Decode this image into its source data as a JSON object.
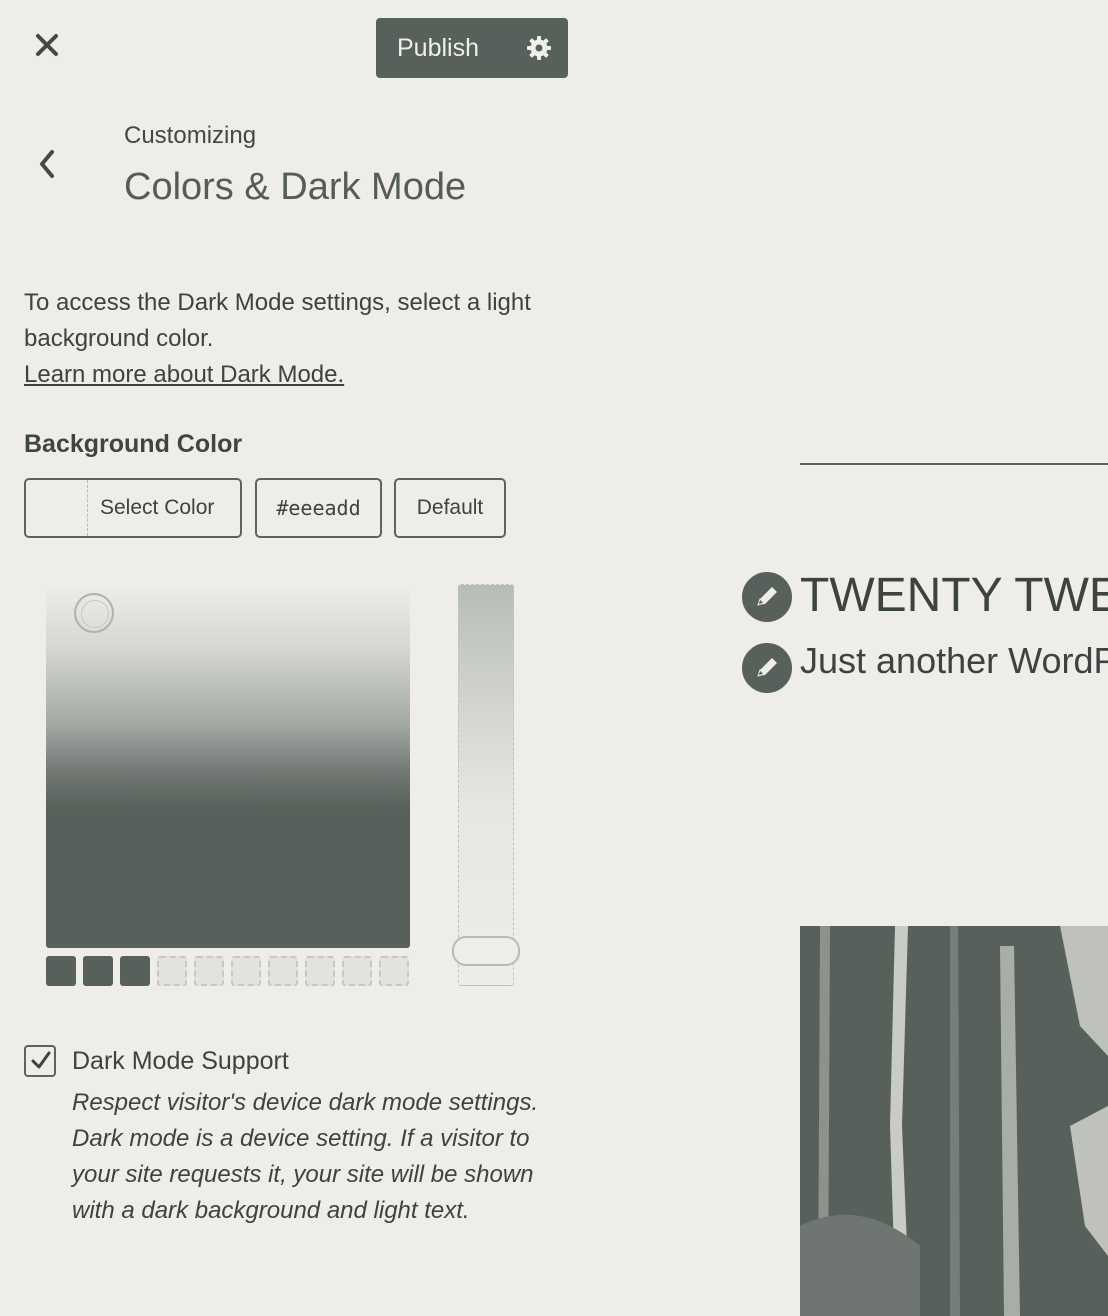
{
  "header": {
    "close_icon": "close-icon",
    "publish_label": "Publish",
    "settings_icon": "gear-icon"
  },
  "panel": {
    "back_icon": "chevron-left-icon",
    "breadcrumb": "Customizing",
    "title": "Colors & Dark Mode"
  },
  "notice": {
    "text": "To access the Dark Mode settings, select a light background color.",
    "link": "Learn more about Dark Mode."
  },
  "background_color": {
    "label": "Background Color",
    "select_label": "Select Color",
    "hex_value": "#eeeadd",
    "default_label": "Default",
    "palette": [
      "dark",
      "dark",
      "dark",
      "light",
      "light",
      "light",
      "light",
      "light",
      "light",
      "light"
    ]
  },
  "dark_mode": {
    "checked": true,
    "label": "Dark Mode Support",
    "description": "Respect visitor's device dark mode settings.\nDark mode is a device setting. If a visitor to your site requests it, your site will be shown with a dark background and light text."
  },
  "preview": {
    "site_title": "TWENTY TWE",
    "tagline": "Just another WordP",
    "edit_icon": "pencil-icon"
  },
  "colors": {
    "accent": "#58605b",
    "background": "#eeede9",
    "text": "#3c4340"
  }
}
